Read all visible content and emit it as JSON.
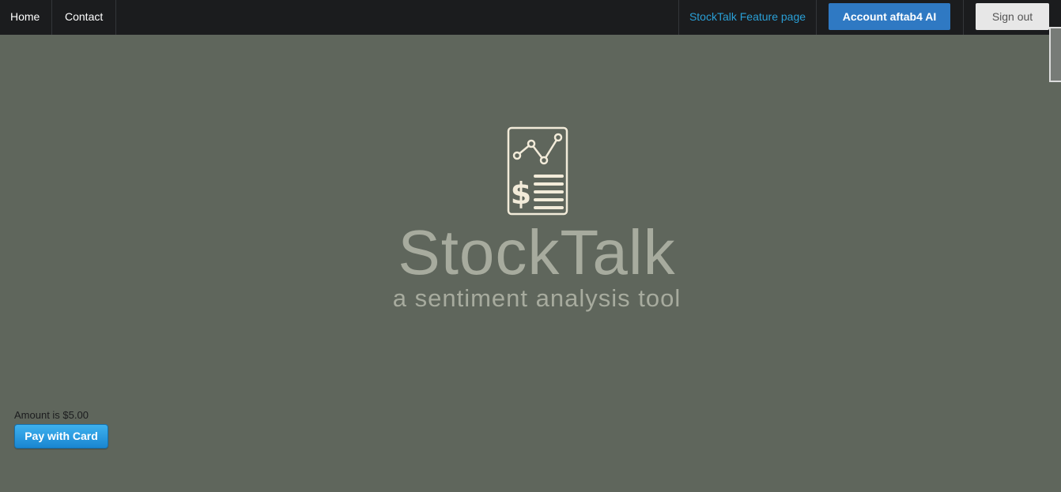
{
  "nav": {
    "home_label": "Home",
    "contact_label": "Contact",
    "feature_label": "StockTalk Feature page",
    "account_label": "Account aftab4 AI",
    "signout_label": "Sign out"
  },
  "hero": {
    "title": "StockTalk",
    "subtitle": "a sentiment analysis tool",
    "logo_icon": "financial-report-chart-icon"
  },
  "payment": {
    "amount_text": "Amount is $5.00",
    "pay_label": "Pay with Card"
  },
  "colors": {
    "background": "#5f665c",
    "navbar": "#1b1c1e",
    "link": "#2a9fd6",
    "account_button": "#2f79c3",
    "brand_text": "#a7ab9e",
    "logo_stroke": "#f2ebd9"
  }
}
